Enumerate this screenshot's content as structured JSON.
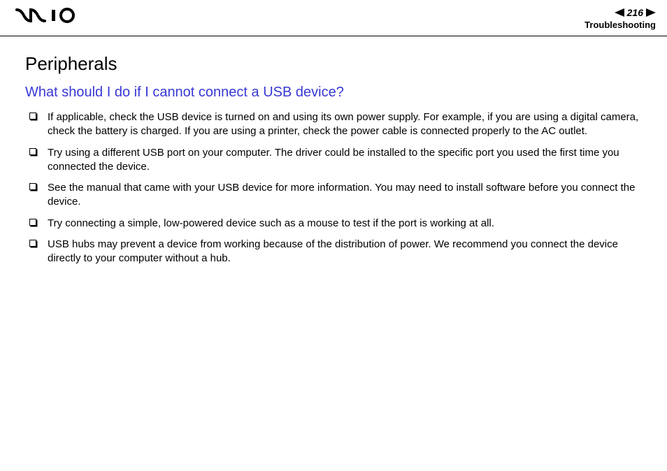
{
  "header": {
    "page_number": "216",
    "section": "Troubleshooting"
  },
  "content": {
    "title": "Peripherals",
    "subheading": "What should I do if I cannot connect a USB device?",
    "bullets": [
      "If applicable, check the USB device is turned on and using its own power supply. For example, if you are using a digital camera, check the battery is charged. If you are using a printer, check the power cable is connected properly to the AC outlet.",
      "Try using a different USB port on your computer. The driver could be installed to the specific port you used the first time you connected the device.",
      "See the manual that came with your USB device for more information. You may need to install software before you connect the device.",
      "Try connecting a simple, low-powered device such as a mouse to test if the port is working at all.",
      "USB hubs may prevent a device from working because of the distribution of power. We recommend you connect the device directly to your computer without a hub."
    ]
  }
}
